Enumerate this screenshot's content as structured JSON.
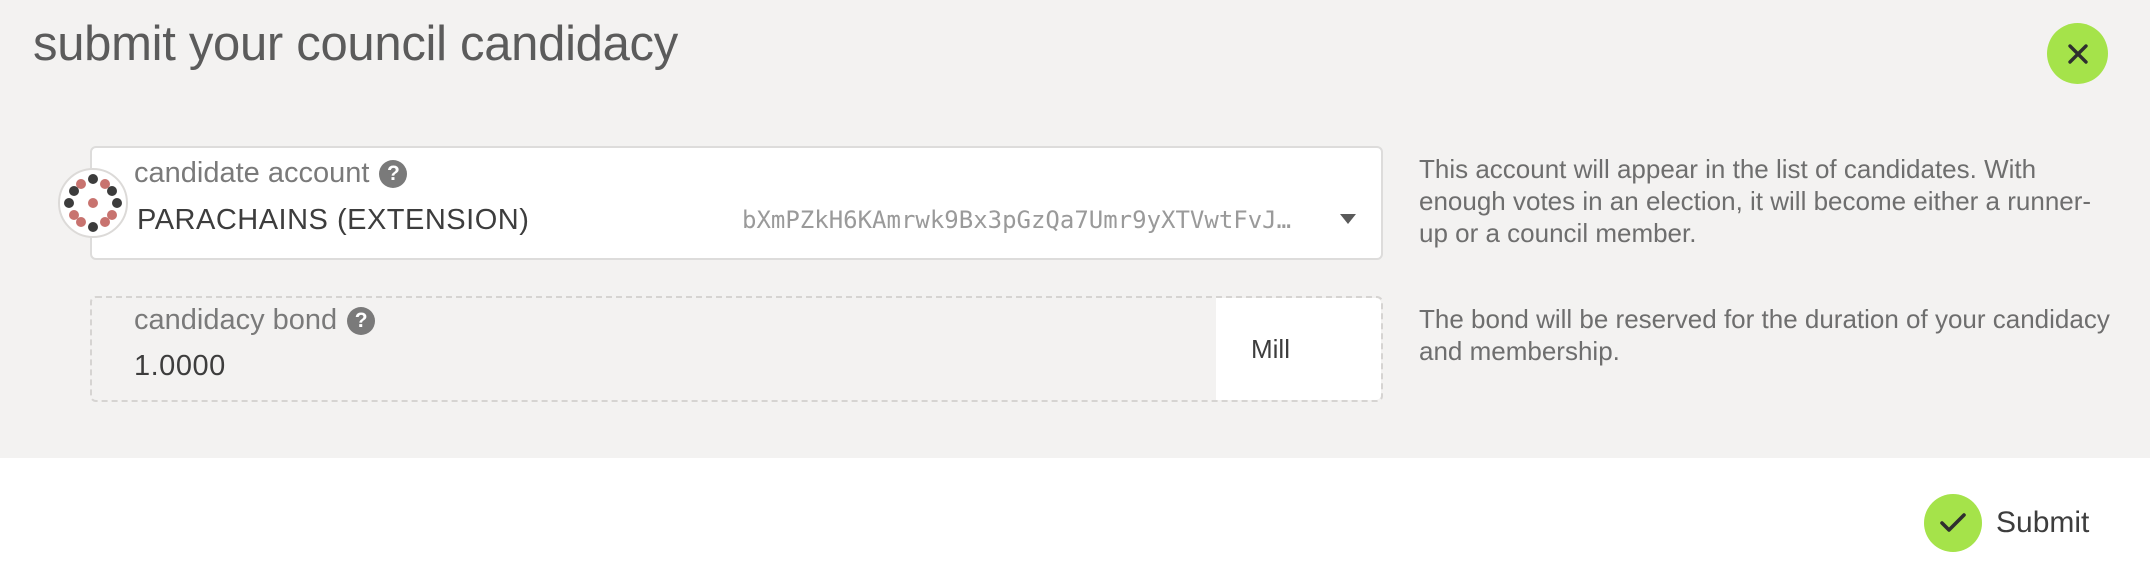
{
  "modal": {
    "title": "submit your council candidacy"
  },
  "candidate": {
    "label": "candidate account",
    "account_name": "PARACHAINS (EXTENSION)",
    "address": "bXmPZkH6KAmrwk9Bx3pGzQa7Umr9yXTVwtFvJ…",
    "help_text": "This account will appear in the list of candidates. With enough votes in an election, it will become either a runner-up or a council member.",
    "icon": "identicon"
  },
  "bond": {
    "label": "candidacy bond",
    "value": "1.0000",
    "unit": "Mill",
    "help_text": "The bond will be reserved for the duration of your candidacy and membership."
  },
  "actions": {
    "submit_label": "Submit",
    "close_icon": "close-icon",
    "submit_icon": "check-icon"
  },
  "colors": {
    "accent": "#a5e34a",
    "modal_background": "#f3f2f1"
  }
}
